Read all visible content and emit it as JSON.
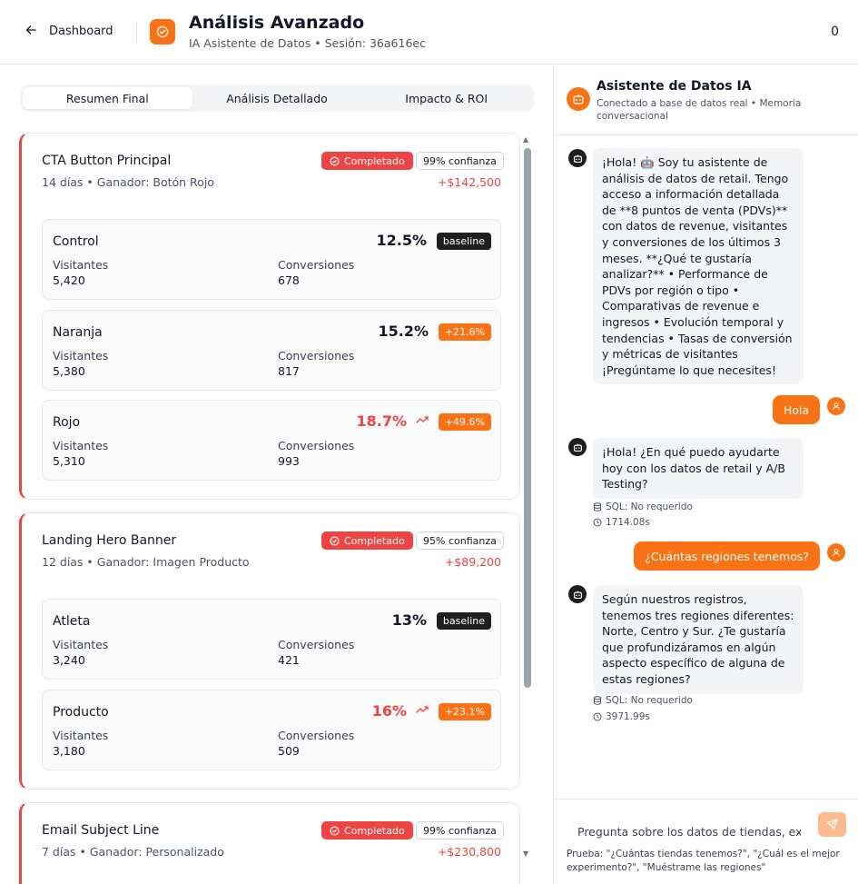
{
  "header": {
    "back_label": "Dashboard",
    "title": "Análisis Avanzado",
    "subtitle": "IA Asistente de Datos • Sesión: 36a616ec",
    "count": "0"
  },
  "tabs": [
    {
      "label": "Resumen Final",
      "active": true
    },
    {
      "label": "Análisis Detallado",
      "active": false
    },
    {
      "label": "Impacto & ROI",
      "active": false
    }
  ],
  "labels": {
    "visitors": "Visitantes",
    "conversions": "Conversiones"
  },
  "experiments": [
    {
      "title": "CTA Button Principal",
      "meta": "14 días • Ganador: Botón Rojo",
      "status": "Completado",
      "confidence": "99% confianza",
      "revenue": "+$142,500",
      "variants": [
        {
          "name": "Control",
          "rate": "12.5%",
          "badge": "baseline",
          "winner": false,
          "visitors": "5,420",
          "conversions": "678"
        },
        {
          "name": "Naranja",
          "rate": "15.2%",
          "badge": "+21.6%",
          "winner": false,
          "visitors": "5,380",
          "conversions": "817"
        },
        {
          "name": "Rojo",
          "rate": "18.7%",
          "badge": "+49.6%",
          "winner": true,
          "visitors": "5,310",
          "conversions": "993"
        }
      ]
    },
    {
      "title": "Landing Hero Banner",
      "meta": "12 días • Ganador: Imagen Producto",
      "status": "Completado",
      "confidence": "95% confianza",
      "revenue": "+$89,200",
      "variants": [
        {
          "name": "Atleta",
          "rate": "13%",
          "badge": "baseline",
          "winner": false,
          "visitors": "3,240",
          "conversions": "421"
        },
        {
          "name": "Producto",
          "rate": "16%",
          "badge": "+23.1%",
          "winner": true,
          "visitors": "3,180",
          "conversions": "509"
        }
      ]
    },
    {
      "title": "Email Subject Line",
      "meta": "7 días • Ganador: Personalizado",
      "status": "Completado",
      "confidence": "99% confianza",
      "revenue": "+$230,800",
      "variants": []
    }
  ],
  "chat": {
    "title": "Asistente de Datos IA",
    "subtitle": "Conectado a base de datos real • Memoria conversacional",
    "messages": [
      {
        "role": "bot",
        "text": "¡Hola! 🤖 Soy tu asistente de análisis de datos de retail. Tengo acceso a información detallada de **8 puntos de venta (PDVs)** con datos de revenue, visitantes y conversiones de los últimos 3 meses. **¿Qué te gustaría analizar?** • Performance de PDVs por región o tipo • Comparativas de revenue e ingresos • Evolución temporal y tendencias • Tasas de conversión y métricas de visitantes ¡Pregúntame lo que necesites!"
      },
      {
        "role": "user",
        "text": "Hola"
      },
      {
        "role": "bot",
        "text": "¡Hola! ¿En qué puedo ayudarte hoy con los datos de retail y A/B Testing?",
        "sql": "SQL: No requerido",
        "time": "1714.08s"
      },
      {
        "role": "user",
        "text": "¿Cuántas regiones tenemos?"
      },
      {
        "role": "bot",
        "text": "Según nuestros registros, tenemos tres regiones diferentes: Norte, Centro y Sur. ¿Te gustaría que profundizáramos en algún aspecto específico de alguna de estas regiones?",
        "sql": "SQL: No requerido",
        "time": "3971.99s"
      }
    ],
    "input_placeholder": "Pregunta sobre los datos de tiendas, exp",
    "hint": "Prueba: \"¿Cuántas tiendas tenemos?\", \"¿Cuál es el mejor experimento?\", \"Muéstrame las regiones\""
  },
  "colors": {
    "accent": "#f97316",
    "danger": "#ef4444",
    "badge_dark": "#1f1f1f"
  }
}
